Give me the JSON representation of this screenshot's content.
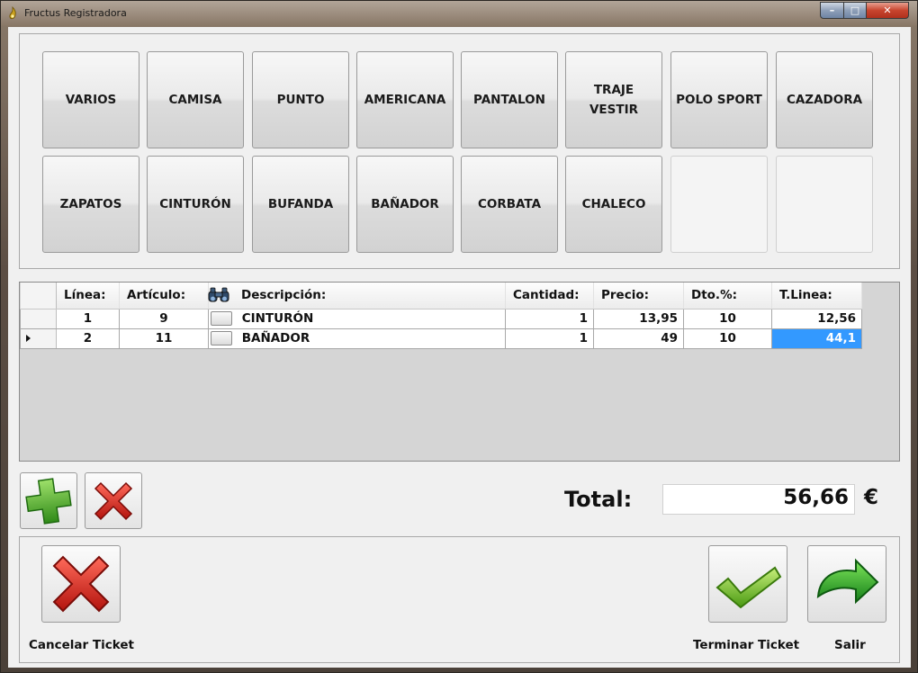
{
  "window": {
    "title": "Fructus Registradora",
    "min_label": "–",
    "max_label": "□",
    "close_label": "✕"
  },
  "categories": [
    {
      "label": "VARIOS"
    },
    {
      "label": "CAMISA"
    },
    {
      "label": "PUNTO"
    },
    {
      "label": "AMERICANA"
    },
    {
      "label": "PANTALON"
    },
    {
      "label": "TRAJE VESTIR"
    },
    {
      "label": "POLO SPORT"
    },
    {
      "label": "CAZADORA"
    },
    {
      "label": "ZAPATOS"
    },
    {
      "label": "CINTURÓN"
    },
    {
      "label": "BUFANDA"
    },
    {
      "label": "BAÑADOR"
    },
    {
      "label": "CORBATA"
    },
    {
      "label": "CHALECO"
    },
    {
      "label": ""
    },
    {
      "label": ""
    }
  ],
  "grid": {
    "columns": {
      "linea": "Línea:",
      "articulo": "Artículo:",
      "descripcion": "Descripción:",
      "cantidad": "Cantidad:",
      "precio": "Precio:",
      "dto": "Dto.%:",
      "tlinea": "T.Linea:"
    },
    "rows": [
      {
        "linea": "1",
        "articulo": "9",
        "descripcion": "CINTURÓN",
        "cantidad": "1",
        "precio": "13,95",
        "dto": "10",
        "tlinea": "12,56",
        "current": false
      },
      {
        "linea": "2",
        "articulo": "11",
        "descripcion": "BAÑADOR",
        "cantidad": "1",
        "precio": "49",
        "dto": "10",
        "tlinea": "44,1",
        "current": true
      }
    ]
  },
  "totals": {
    "label": "Total:",
    "value": "56,66",
    "currency": "€"
  },
  "actions": {
    "cancel_ticket": "Cancelar Ticket",
    "finish_ticket": "Terminar Ticket",
    "exit": "Salir"
  },
  "colors": {
    "selection": "#3399ff",
    "add_green": "#4caf2a",
    "delete_red": "#d0201a",
    "exit_green": "#2ea82a"
  },
  "icons": {
    "add_line": "plus-icon",
    "delete_line": "x-icon",
    "search": "binoculars-icon",
    "cancel": "x-icon",
    "finish": "check-icon",
    "exit": "arrow-exit-icon"
  }
}
